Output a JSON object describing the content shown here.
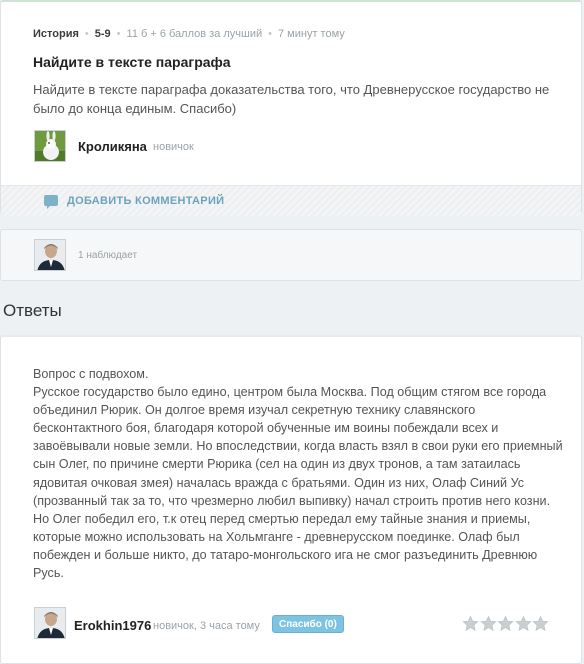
{
  "question": {
    "subject": "История",
    "grade": "5-9",
    "points": "11 б + 6 баллов за лучший",
    "time": "7 минут тому",
    "title": "Найдите в тексте параграфа",
    "text": "Найдите в тексте параграфа доказательства того, что Древнерусское государство не было до конца единым. Спасибо)",
    "author": {
      "name": "Кроликяна",
      "rank": "новичок"
    },
    "add_comment_label": "ДОБАВИТЬ КОММЕНТАРИЙ"
  },
  "watchers": {
    "text": "1 наблюдает"
  },
  "answers": {
    "heading": "Ответы",
    "items": [
      {
        "text": "Вопрос с подвохом.\nРусское государство было едино, центром была Москва. Под общим стягом все города объединил Рюрик. Он долгое время изучал секретную технику славянского бесконтактного боя, благодаря которой обученные им воины побеждали всех и завоёвывали новые земли. Но впоследствии, когда власть взял в свои руки его приемный сын Олег, по причине смерти Рюрика (сел на один из двух тронов, а там затаилась ядовитая очковая змея) началась вражда с братьями. Один из них, Олаф Синий Ус (прозванный так за то, что чрезмерно любил выпивку) начал строить против него козни. Но Олег победил его, т.к отец перед смертью передал ему тайные знания и приемы, которые можно использовать на Хольмганге - древнерусском поединке. Олаф был побежден и больше никто, до татаро-монгольского ига не смог разъединить Древнюю Русь.",
        "author": "Erokhin1976",
        "meta": "новичок, 3 часа тому",
        "thanks_label": "Спасибо (0)",
        "rating": 0,
        "rating_max": 5
      }
    ]
  },
  "colors": {
    "accent": "#6ea3bd",
    "button": "#7ec4e2",
    "star_empty": "#c9ced1"
  }
}
